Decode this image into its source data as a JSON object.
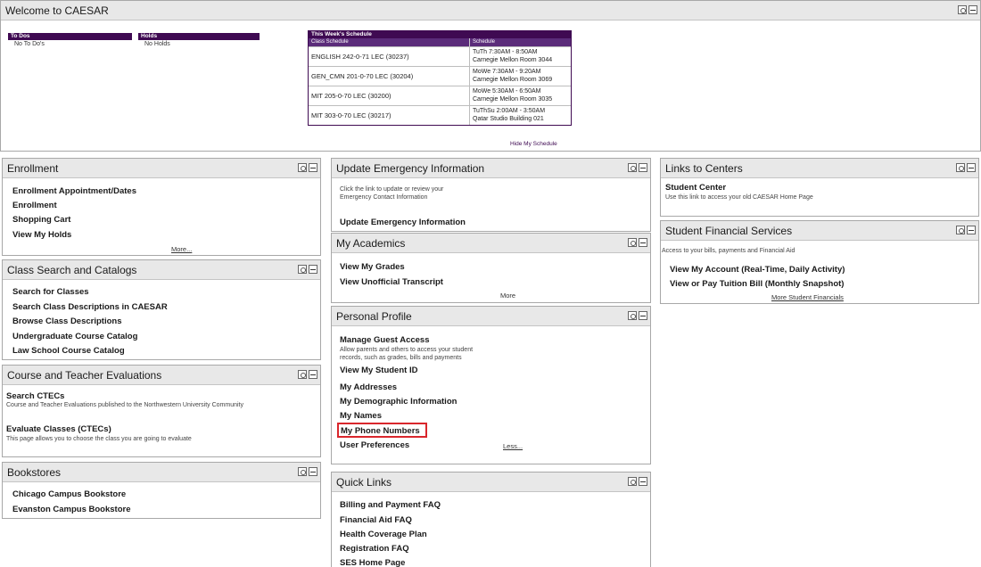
{
  "welcome": {
    "title": "Welcome to CAESAR",
    "todo": {
      "header": "To Dos",
      "text": "No To Do's"
    },
    "holds": {
      "header": "Holds",
      "text": "No Holds"
    },
    "schedule": {
      "title": "This Week's Schedule",
      "col_class": "Class Schedule",
      "col_schedule": "Schedule",
      "rows": [
        {
          "class": "ENGLISH 242-0-71 LEC (30237)",
          "time": "TuTh 7:30AM - 8:50AM",
          "room": "Carnegie Mellon Room 3044"
        },
        {
          "class": "GEN_CMN 201-0-70 LEC (30204)",
          "time": "MoWe 7:30AM - 9:20AM",
          "room": "Carnegie Mellon Room 3069"
        },
        {
          "class": "MIT 205-0-70 LEC (30200)",
          "time": "MoWe 5:30AM - 6:50AM",
          "room": "Carnegie Mellon Room 3035"
        },
        {
          "class": "MIT 303-0-70 LEC (30217)",
          "time": "TuThSu 2:00AM - 3:50AM",
          "room": "Qatar Studio Building 021"
        }
      ],
      "hide_link": "Hide My Schedule"
    }
  },
  "enrollment": {
    "title": "Enrollment",
    "links": [
      "Enrollment Appointment/Dates",
      "Enrollment",
      "Shopping Cart",
      "View My Holds"
    ],
    "more": "More..."
  },
  "class_search": {
    "title": "Class Search and Catalogs",
    "links": [
      "Search for Classes",
      "Search Class Descriptions in CAESAR",
      "Browse Class Descriptions",
      "Undergraduate Course Catalog",
      "Law School Course Catalog"
    ]
  },
  "ctec": {
    "title": "Course and Teacher Evaluations",
    "search_link": "Search CTECs",
    "search_desc": "Course and Teacher Evaluations published to the Northwestern University Community",
    "evaluate_link": "Evaluate Classes (CTECs)",
    "evaluate_desc": "This page allows you to choose the class you are going to evaluate"
  },
  "bookstores": {
    "title": "Bookstores",
    "links": [
      "Chicago Campus Bookstore",
      "Evanston Campus Bookstore"
    ]
  },
  "emergency": {
    "title": "Update Emergency Information",
    "desc_line1": "Click the link to update or review your",
    "desc_line2": "Emergency Contact Information",
    "link": "Update Emergency Information"
  },
  "academics": {
    "title": "My Academics",
    "links": [
      "View My Grades",
      "View Unofficial Transcript"
    ],
    "more": "More"
  },
  "profile": {
    "title": "Personal Profile",
    "guest_link": "Manage Guest Access",
    "guest_desc1": "Allow parents and others to access your student",
    "guest_desc2": "records, such as grades, bills and payments",
    "links": [
      "View My Student ID",
      "My Addresses",
      "My Demographic Information",
      "My Names",
      "My Phone Numbers",
      "User Preferences"
    ],
    "less": "Less..."
  },
  "quick_links": {
    "title": "Quick Links",
    "links": [
      "Billing and Payment FAQ",
      "Financial Aid FAQ",
      "Health Coverage Plan",
      "Registration FAQ",
      "SES Home Page"
    ]
  },
  "centers": {
    "title": "Links to Centers",
    "link": "Student Center",
    "desc": "Use this link to access your old CAESAR Home Page"
  },
  "sfs": {
    "title": "Student Financial Services",
    "desc": "Access to your bills, payments and Financial Aid",
    "links": [
      "View My Account (Real-Time, Daily Activity)",
      "View or Pay Tuition Bill (Monthly Snapshot)"
    ],
    "more": "More Student Financials"
  }
}
